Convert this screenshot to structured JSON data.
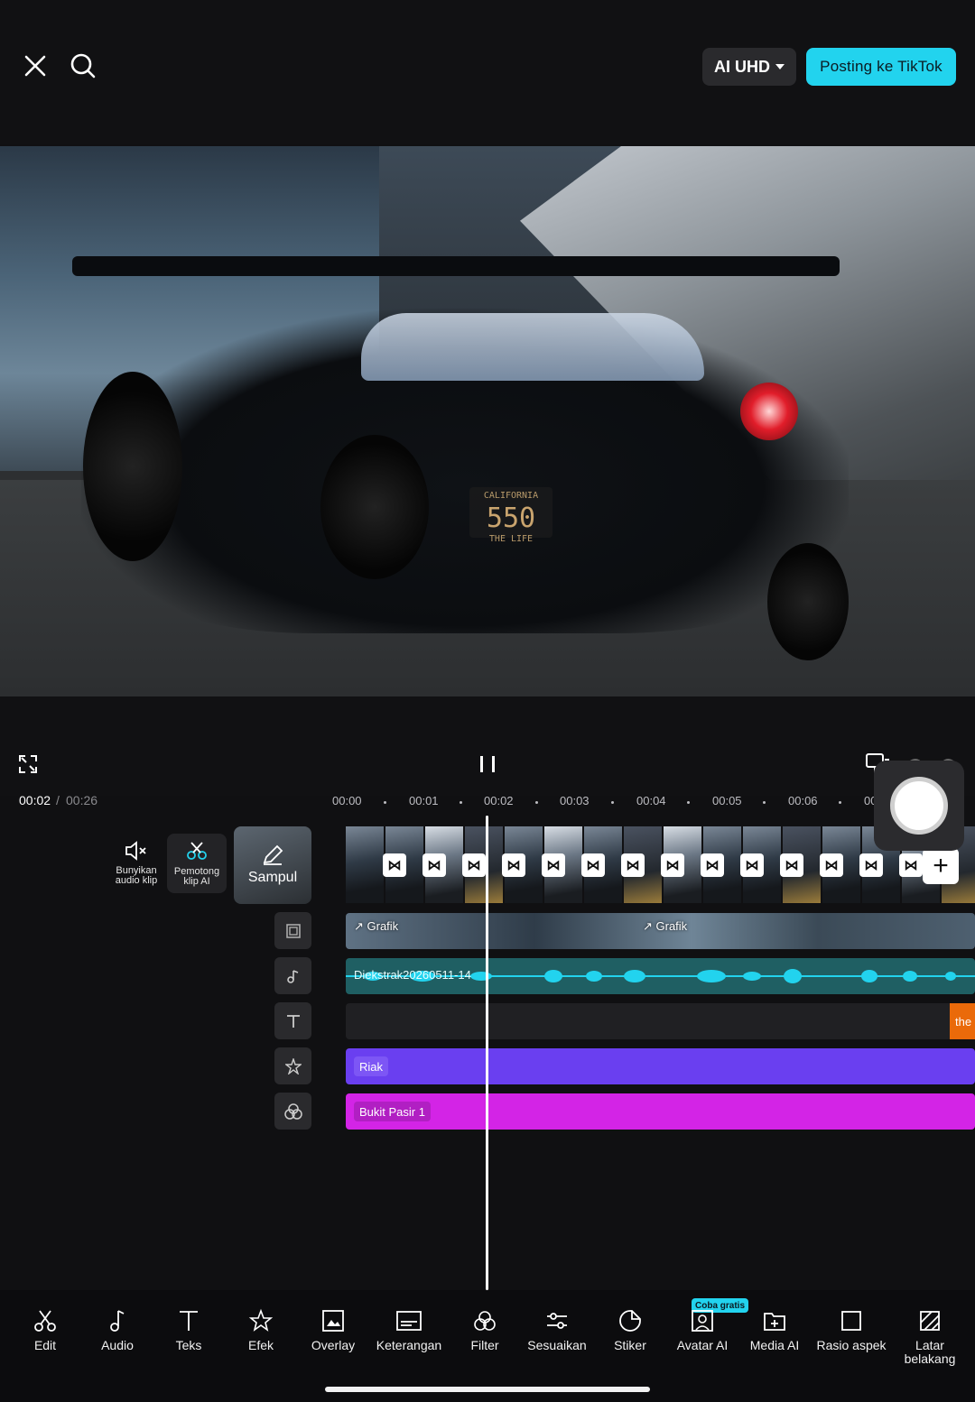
{
  "header": {
    "quality_label": "AI UHD",
    "post_label": "Posting ke TikTok"
  },
  "preview": {
    "plate_top": "CALIFORNIA",
    "plate_number": "550",
    "plate_bottom": "THE LIFE"
  },
  "playback": {
    "current_time": "00:02",
    "separator": "/",
    "total_time": "00:26"
  },
  "ruler": {
    "ticks": [
      "00:00",
      "00:01",
      "00:02",
      "00:03",
      "00:04",
      "00:05",
      "00:06",
      "00"
    ]
  },
  "side_tools": {
    "mute_label": "Bunyikan audio klip",
    "ai_cut_label": "Pemotong klip AI",
    "cover_label": "Sampul"
  },
  "tracks": {
    "overlay_label_1": "Grafik",
    "overlay_label_2": "Grafik",
    "audio_label": "Diekstrak20260511-14",
    "text_clip_label": "the",
    "effect_label": "Riak",
    "filter_label": "Bukit Pasir 1"
  },
  "toolbar": {
    "items": [
      {
        "label": "Edit",
        "icon": "scissors-icon"
      },
      {
        "label": "Audio",
        "icon": "music-note-icon"
      },
      {
        "label": "Teks",
        "icon": "text-icon"
      },
      {
        "label": "Efek",
        "icon": "star-effect-icon"
      },
      {
        "label": "Overlay",
        "icon": "overlay-icon"
      },
      {
        "label": "Keterangan",
        "icon": "captions-icon"
      },
      {
        "label": "Filter",
        "icon": "filter-icon"
      },
      {
        "label": "Sesuaikan",
        "icon": "adjust-icon"
      },
      {
        "label": "Stiker",
        "icon": "sticker-icon"
      },
      {
        "label": "Avatar AI",
        "icon": "avatar-ai-icon"
      },
      {
        "label": "Media AI",
        "icon": "media-ai-icon"
      },
      {
        "label": "Rasio aspek",
        "icon": "aspect-ratio-icon"
      },
      {
        "label": "Latar belakang",
        "icon": "background-icon"
      }
    ],
    "badge": "Coba gratis"
  },
  "colors": {
    "accent": "#22d3ee",
    "effect_track": "#6a3ff0",
    "filter_track": "#d324e6",
    "audio_track": "#1f5f63",
    "text_clip": "#ea6a0a"
  }
}
